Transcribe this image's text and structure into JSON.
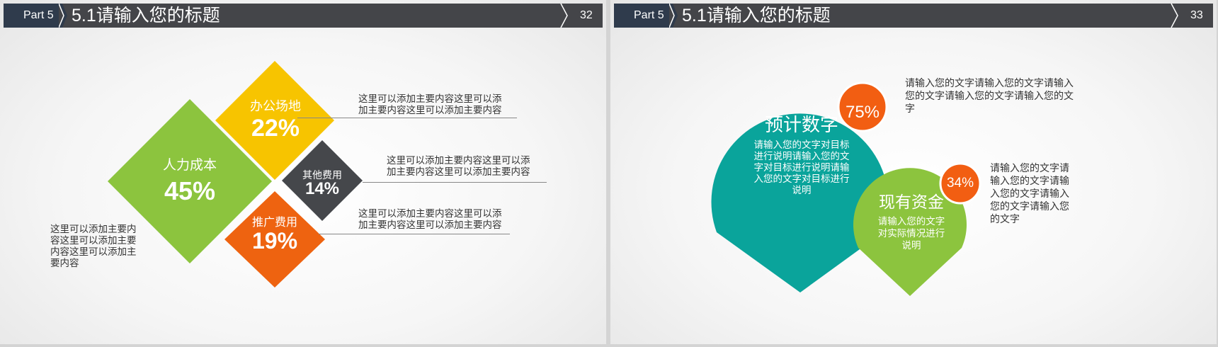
{
  "slides": [
    {
      "header": {
        "part": "Part 5",
        "title": "5.1请输入您的标题",
        "page": "32"
      },
      "diamonds": {
        "hr": {
          "label": "人力成本",
          "percent": "45%",
          "color": "#8cc43e"
        },
        "office": {
          "label": "办公场地",
          "percent": "22%",
          "color": "#f7c400"
        },
        "other": {
          "label": "其他费用",
          "percent": "14%",
          "color": "#45474b"
        },
        "promo": {
          "label": "推广费用",
          "percent": "19%",
          "color": "#ee6310"
        }
      },
      "texts": {
        "office_desc": [
          "这里可以添加主要内容这里可以添",
          "加主要内容这里可以添加主要内容"
        ],
        "other_desc": [
          "这里可以添加主要内容这里可以添",
          "加主要内容这里可以添加主要内容"
        ],
        "promo_desc": [
          "这里可以添加主要内容这里可以添",
          "加主要内容这里可以添加主要内容"
        ],
        "hr_desc": [
          "这里可以添加主要内",
          "容这里可以添加主要",
          "内容这里可以添加主",
          "要内容"
        ]
      }
    },
    {
      "header": {
        "part": "Part 5",
        "title": "5.1请输入您的标题",
        "page": "33"
      },
      "teal": {
        "title": "预计数字",
        "desc": [
          "请输入您的文字对目标",
          "进行说明请输入您的文",
          "字对目标进行说明请输",
          "入您的文字对目标进行",
          "说明"
        ],
        "badge": "75%",
        "color": "#0aa49b"
      },
      "green": {
        "title": "现有资金",
        "desc": [
          "请输入您的文字",
          "对实际情况进行",
          "说明"
        ],
        "badge": "34%",
        "color": "#8cc43e"
      },
      "badge_color": "#f25e12",
      "texts": {
        "top_desc": [
          "请输入您的文字请输入您的文字请输入",
          "您的文字请输入您的文字请输入您的文",
          "字"
        ],
        "mid_desc": [
          "请输入您的文字请",
          "输入您的文字请输",
          "入您的文字请输入",
          "您的文字请输入您",
          "的文字"
        ]
      }
    }
  ]
}
